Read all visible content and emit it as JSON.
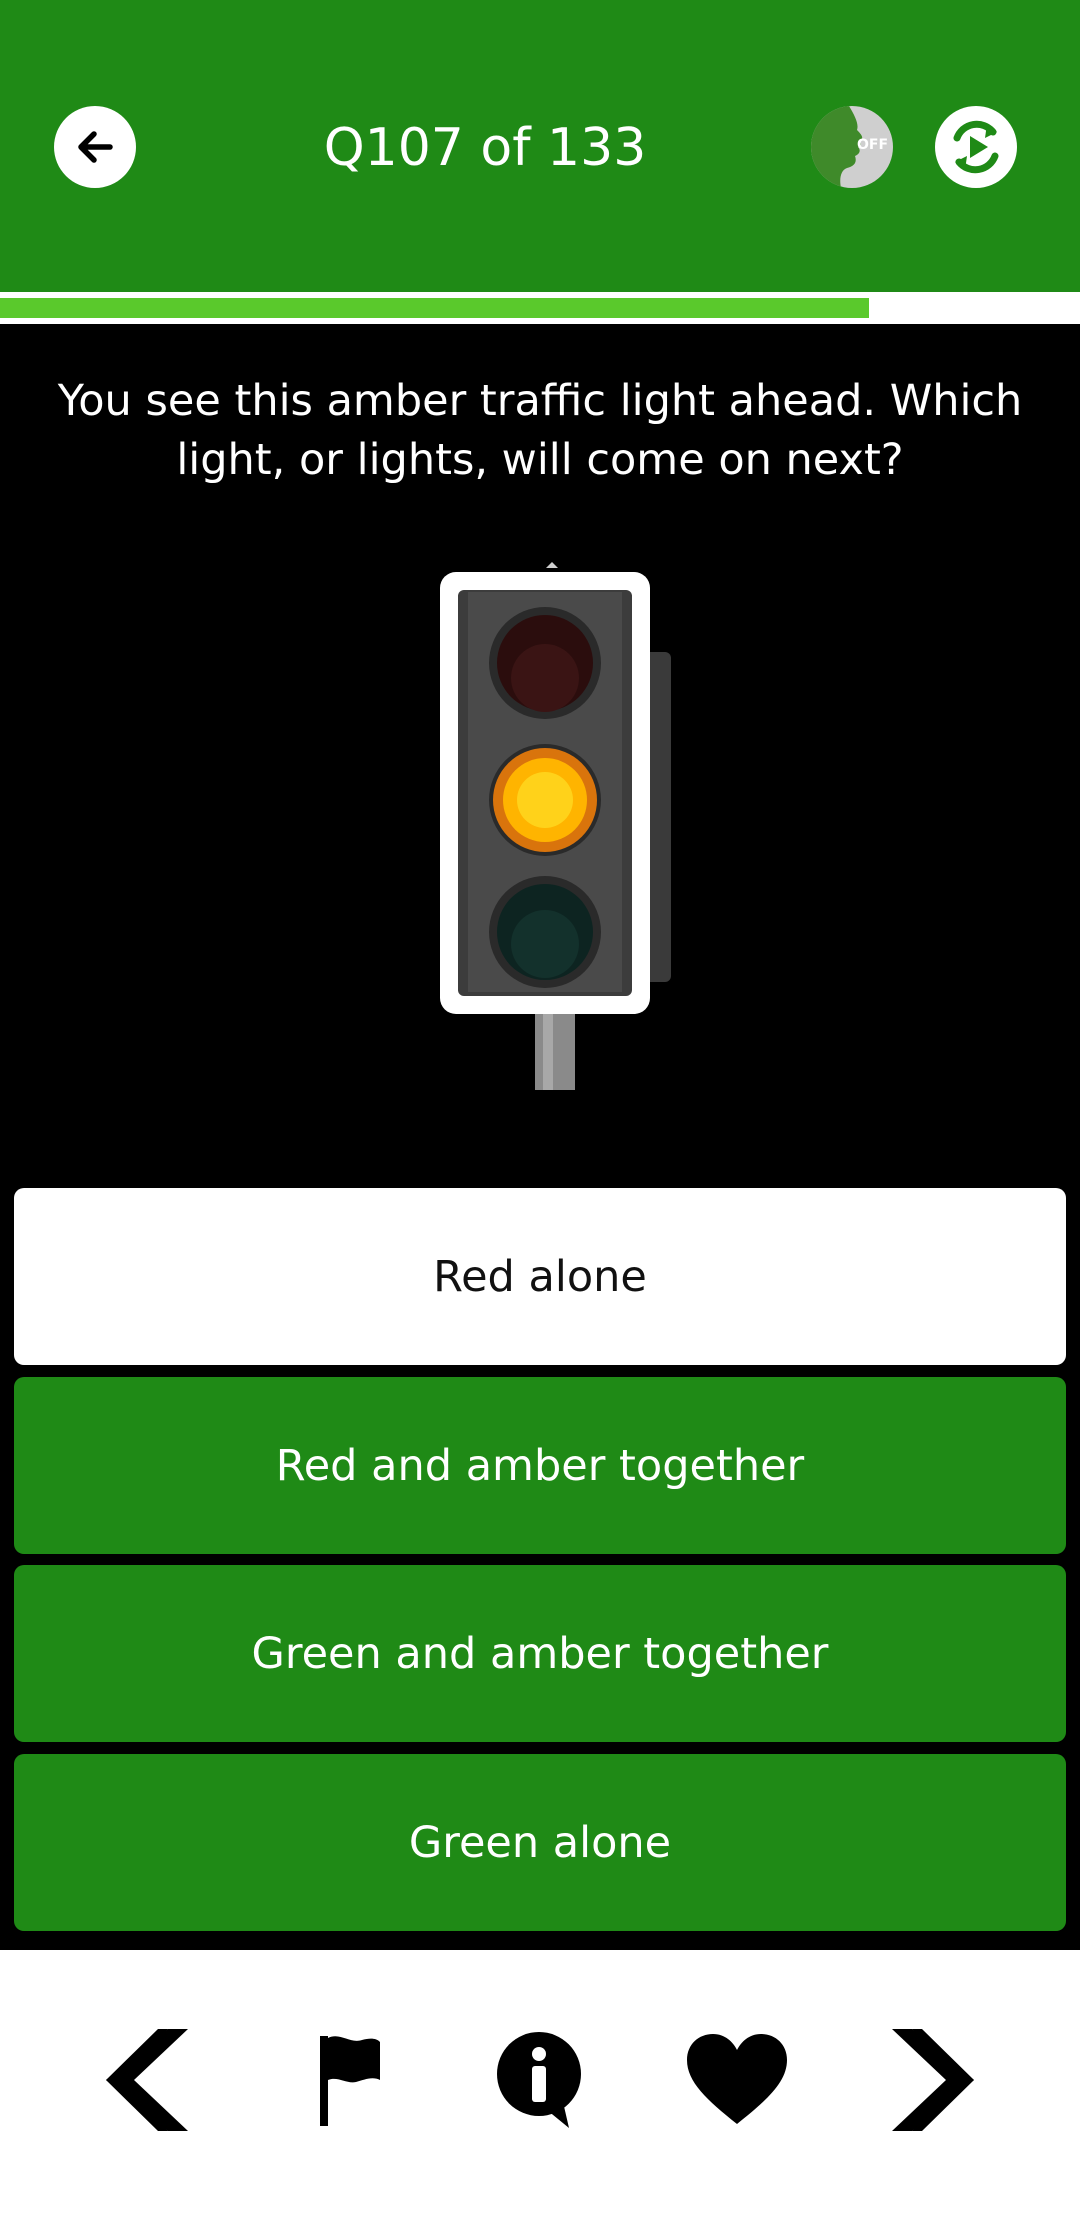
{
  "header": {
    "title": "Q107 of 133",
    "voice_label": "OFF",
    "back_icon": "arrow-left-icon",
    "restart_icon": "restart-play-icon",
    "background_color": "#1f8a16"
  },
  "progress": {
    "current": 107,
    "total": 133,
    "fraction": 0.805,
    "fill_color": "#5ac92c"
  },
  "question": {
    "text": "You see this amber traffic light ahead. Which light, or lights, will come on next?",
    "image_icon": "traffic-light-amber-icon"
  },
  "answers": [
    {
      "label": "Red alone",
      "selected": true
    },
    {
      "label": "Red and amber together",
      "selected": false
    },
    {
      "label": "Green and amber together",
      "selected": false
    },
    {
      "label": "Green alone",
      "selected": false
    }
  ],
  "bottom_nav": {
    "items": [
      "previous-icon",
      "flag-icon",
      "info-icon",
      "heart-icon",
      "next-icon"
    ]
  },
  "colors": {
    "accent": "#1f8a16",
    "selected_answer": "#ffffff",
    "background": "#000000"
  }
}
